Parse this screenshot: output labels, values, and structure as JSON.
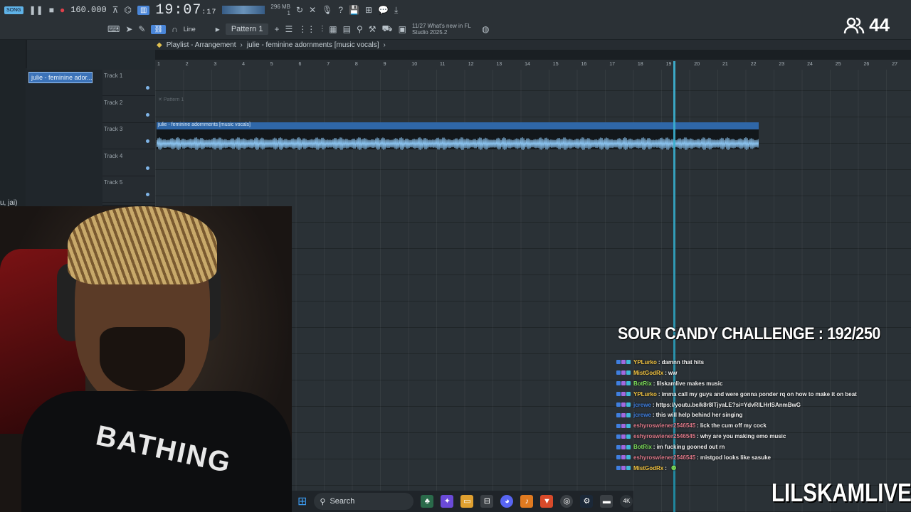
{
  "toolbar": {
    "song_tag": "SONG",
    "tempo": "160.000",
    "time": "19:07",
    "time_sub": ":17",
    "cpu": "296 MB",
    "cpu_sub": "1",
    "snap_label": "Line",
    "pattern_label": "Pattern 1",
    "news_line1": "11/27  What's new in FL",
    "news_line2": "Studio 2025.2"
  },
  "stream": {
    "viewer_count": "44",
    "challenge": "SOUR CANDY CHALLENGE : 192/250",
    "brand": "LILSKAMLIVE"
  },
  "playlist": {
    "title": "Playlist - Arrangement",
    "breadcrumb": "julie - feminine adornments [music vocals]",
    "clip_picker": "julie - feminine ador...",
    "ruler": [
      "1",
      "2",
      "3",
      "4",
      "5",
      "6",
      "7",
      "8",
      "9",
      "10",
      "11",
      "12",
      "13",
      "14",
      "15",
      "16",
      "17",
      "18",
      "19",
      "20",
      "21",
      "22",
      "23",
      "24",
      "25",
      "26",
      "27"
    ],
    "tracks": [
      "Track 1",
      "Track 2",
      "Track 3",
      "Track 4",
      "Track 5"
    ],
    "ghost_pattern": "Pattern 1",
    "audio_clip_label": "julie - feminine adornments [music vocals]",
    "side_text": "u, jai)"
  },
  "chat": [
    {
      "user": "YPLurko",
      "color": "#f4c542",
      "text": "damnn that hits"
    },
    {
      "user": "MistGodRx",
      "color": "#f4c542",
      "text": "ww"
    },
    {
      "user": "BotRix",
      "color": "#7ee05a",
      "text": "lilskamlive makes music"
    },
    {
      "user": "YPLurko",
      "color": "#f4c542",
      "text": "imma call my guys and were gonna ponder rq on how to make it on beat"
    },
    {
      "user": "jcrewe",
      "color": "#3f7fe0",
      "text": "https://youtu.be/k8r8lTjyaLE?si=YdvRILHrlSAnmBwG"
    },
    {
      "user": "jcrewe",
      "color": "#3f7fe0",
      "text": "this will help behind her singing"
    },
    {
      "user": "eshyroswiener2546545",
      "color": "#e07a8a",
      "text": "lick the cum off my cock"
    },
    {
      "user": "eshyroswiener2546545",
      "color": "#e07a8a",
      "text": "why are you making emo music"
    },
    {
      "user": "BotRix",
      "color": "#7ee05a",
      "text": "im fucking gooned out rn"
    },
    {
      "user": "eshyroswiener2546545",
      "color": "#e07a8a",
      "text": "mistgod looks like sasuke"
    },
    {
      "user": "MistGodRx",
      "color": "#f4c542",
      "text": ""
    }
  ],
  "shirt_text": "BATHING",
  "taskbar": {
    "search_label": "Search"
  }
}
